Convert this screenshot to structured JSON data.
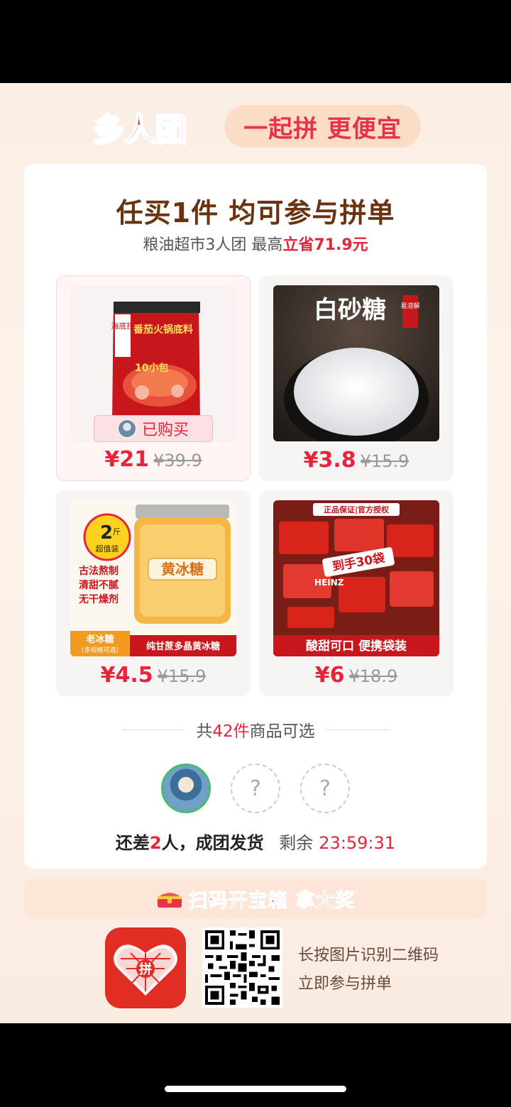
{
  "header": {
    "brand": "多人团",
    "slogan": "一起拼 更便宜"
  },
  "card": {
    "title": "任买1件 均可参与拼单",
    "subtitle_prefix": "粮油超市3人团 最高",
    "subtitle_highlight": "立省71.9元"
  },
  "products": [
    {
      "image_labels": {
        "brand": "海底捞",
        "name": "番茄火锅底料",
        "pack": "10小包"
      },
      "tag": "已购买",
      "price": "¥21",
      "orig_price": "¥39.9"
    },
    {
      "image_labels": {
        "name": "白砂糖",
        "badge": "易溶解"
      },
      "price": "¥3.8",
      "orig_price": "¥15.9"
    },
    {
      "image_labels": {
        "weight_num": "2",
        "weight_unit": "斤",
        "weight_tag": "超值装",
        "features": [
          "古法熬制",
          "清甜不腻",
          "无干燥剂"
        ],
        "jar": "黄冰糖",
        "bottom_left": "老冰糖",
        "bottom_left_sub": "(多规格可选)",
        "bottom_right": "纯甘蔗多晶黄冰糖"
      },
      "price": "¥4.5",
      "orig_price": "¥15.9"
    },
    {
      "image_labels": {
        "top": "正品保证|官方授权",
        "badge": "到手30袋",
        "bottom": "酸甜可口 便携袋装",
        "brand": "HEINZ"
      },
      "price": "¥6",
      "orig_price": "¥18.9"
    }
  ],
  "total": {
    "prefix": "共",
    "count": "42件",
    "suffix": "商品可选"
  },
  "avatars": {
    "placeholder": "?"
  },
  "status": {
    "prefix": "还差",
    "num": "2",
    "suffix": "人，成团发货",
    "remain_label": "剩余",
    "timer": "23:59:31"
  },
  "banner": {
    "text": "扫码开宝箱 拿大奖"
  },
  "footer": {
    "app_icon_text": "拼",
    "line1": "长按图片识别二维码",
    "line2": "立即参与拼单"
  },
  "colors": {
    "accent": "#e8243c",
    "brand_pink": "#e8266d",
    "title_brown": "#6a3210"
  }
}
